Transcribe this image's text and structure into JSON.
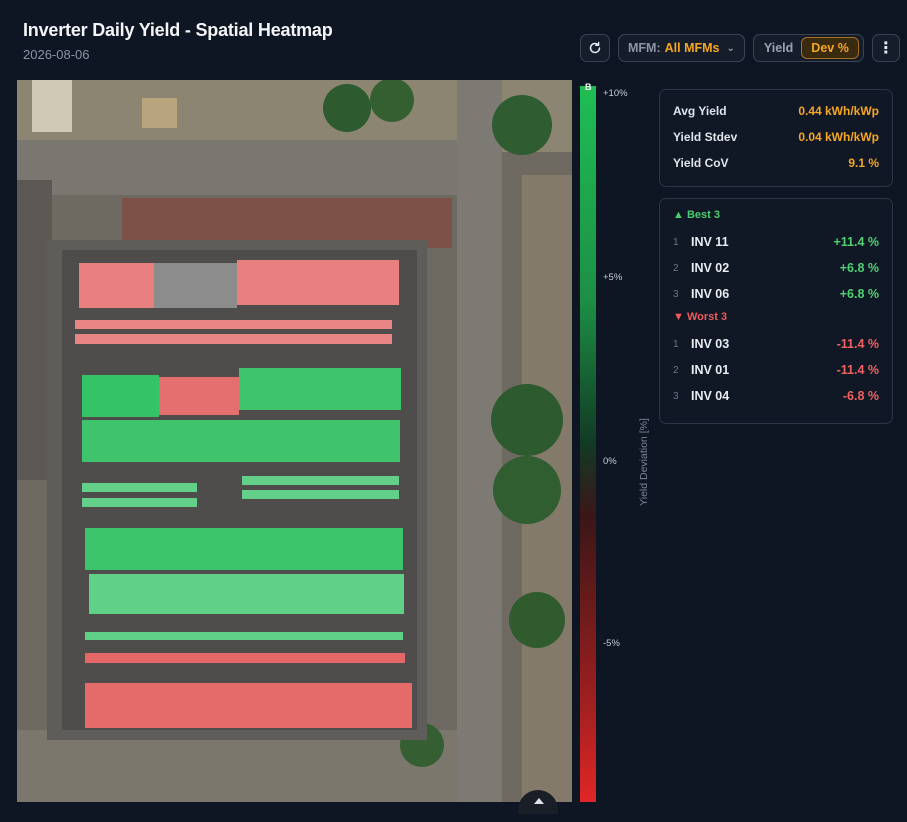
{
  "header": {
    "title": "Inverter Daily Yield - Spatial Heatmap",
    "date": "2026-08-06"
  },
  "toolbar": {
    "refresh_icon": "refresh-icon",
    "mfm_label": "MFM:",
    "mfm_value": "All MFMs",
    "mfm_chevron": "chevron-down-icon",
    "mode_yield": "Yield",
    "mode_dev": "Dev %",
    "active_mode": "Dev %",
    "more_icon": "more-vertical-icon"
  },
  "colorbar": {
    "top_marker": "B",
    "ticks": [
      "+10%",
      "+5%",
      "0%",
      "-5%"
    ],
    "title": "Yield Deviation [%]",
    "colors": {
      "positive": "#1fbe55",
      "neutral": "#123a24",
      "negative": "#e02626"
    }
  },
  "stats": [
    {
      "label": "Avg Yield",
      "value": "0.44 kWh/kWp"
    },
    {
      "label": "Yield Stdev",
      "value": "0.04 kWh/kWp"
    },
    {
      "label": "Yield CoV",
      "value": "9.1 %"
    }
  ],
  "best": {
    "title": "▲ Best 3",
    "items": [
      {
        "rank": "1",
        "name": "INV 11",
        "value": "+11.4 %"
      },
      {
        "rank": "2",
        "name": "INV 02",
        "value": "+6.8 %"
      },
      {
        "rank": "3",
        "name": "INV 06",
        "value": "+6.8 %"
      }
    ]
  },
  "worst": {
    "title": "▼ Worst 3",
    "items": [
      {
        "rank": "1",
        "name": "INV 03",
        "value": "-11.4 %"
      },
      {
        "rank": "2",
        "name": "INV 01",
        "value": "-11.4 %"
      },
      {
        "rank": "3",
        "name": "INV 04",
        "value": "-6.8 %"
      }
    ]
  },
  "accent_colors": {
    "orange": "#f5a623",
    "green": "#4fd171",
    "red": "#f06262"
  }
}
